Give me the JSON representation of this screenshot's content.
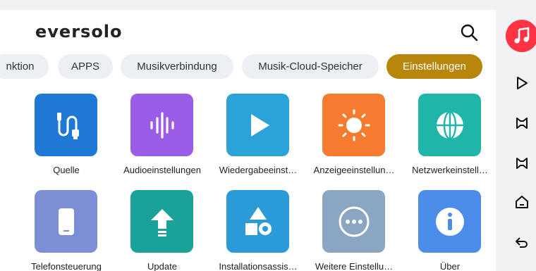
{
  "header": {
    "brand": "eversolo"
  },
  "tabs": [
    {
      "label": "nktion",
      "active": false
    },
    {
      "label": "APPS",
      "active": false
    },
    {
      "label": "Musikverbindung",
      "active": false
    },
    {
      "label": "Musik-Cloud-Speicher",
      "active": false
    },
    {
      "label": "Einstellungen",
      "active": true
    }
  ],
  "grid": [
    {
      "label": "Quelle",
      "icon": "cable-icon",
      "color": "#1f77d6"
    },
    {
      "label": "Audioeinstellungen",
      "icon": "waveform-icon",
      "color": "#9b5de5"
    },
    {
      "label": "Wiedergabeeinst…",
      "icon": "play-icon",
      "color": "#2ba3d8"
    },
    {
      "label": "Anzeigeeinstellun…",
      "icon": "sun-icon",
      "color": "#f57c2e"
    },
    {
      "label": "Netzwerkeinstell…",
      "icon": "globe-icon",
      "color": "#1fb5a8"
    },
    {
      "label": "Telefonsteuerung",
      "icon": "phone-icon",
      "color": "#7b8ed6"
    },
    {
      "label": "Update",
      "icon": "upload-arrow-icon",
      "color": "#1aa29a"
    },
    {
      "label": "Installationsassis…",
      "icon": "shapes-icon",
      "color": "#2a9bd6"
    },
    {
      "label": "Weitere Einstellu…",
      "icon": "more-dots-icon",
      "color": "#8aa6c2"
    },
    {
      "label": "Über",
      "icon": "info-icon",
      "color": "#4b8de8"
    }
  ],
  "rail": {
    "music_icon": "music-note-icon",
    "items": [
      "play-outline-icon",
      "mirror-icon",
      "mirror-icon",
      "home-icon",
      "back-icon"
    ]
  }
}
